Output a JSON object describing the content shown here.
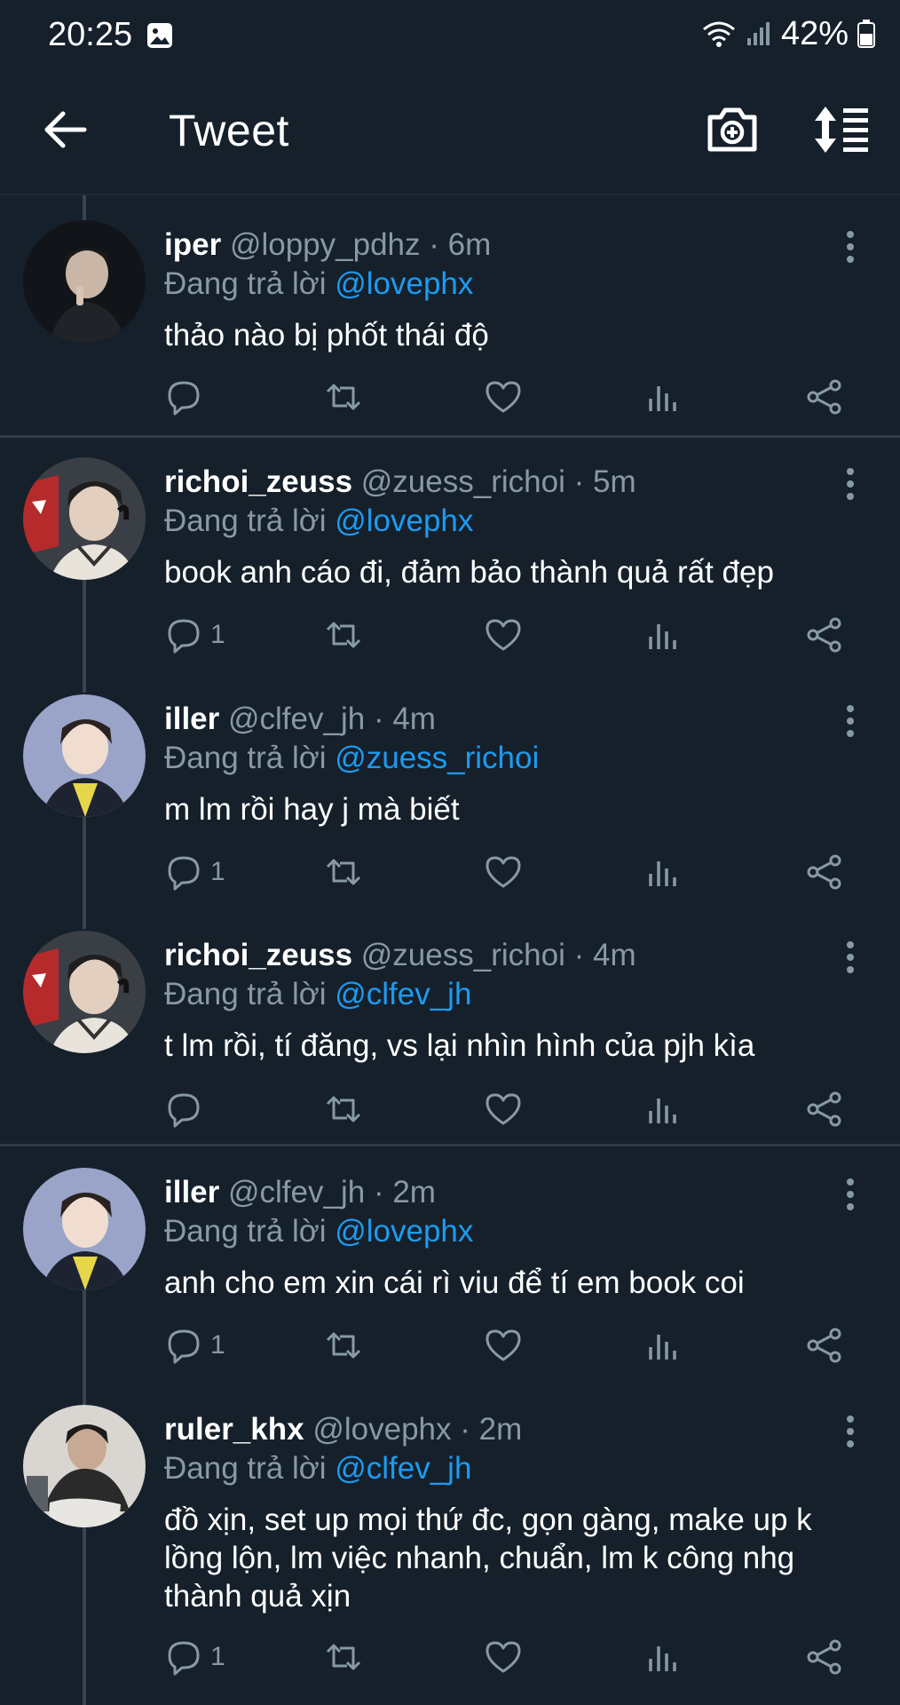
{
  "status": {
    "time": "20:25",
    "battery": "42%"
  },
  "header": {
    "title": "Tweet"
  },
  "tweets": [
    {
      "name": "iper",
      "handle": "@loppy_pdhz",
      "time": "· 6m",
      "reply_prefix": "Đang trả lời",
      "reply_to": "@lovephx",
      "text": "thảo nào bị phốt thái độ",
      "reply_count": ""
    },
    {
      "name": "richoi_zeuss",
      "handle": "@zuess_richoi",
      "time": "· 5m",
      "reply_prefix": "Đang trả lời",
      "reply_to": "@lovephx",
      "text": "book anh cáo đi, đảm bảo thành quả rất đẹp",
      "reply_count": "1"
    },
    {
      "name": "iller",
      "handle": "@clfev_jh",
      "time": "· 4m",
      "reply_prefix": "Đang trả lời",
      "reply_to": "@zuess_richoi",
      "text": "m lm rồi hay j mà biết",
      "reply_count": "1"
    },
    {
      "name": "richoi_zeuss",
      "handle": "@zuess_richoi",
      "time": "· 4m",
      "reply_prefix": "Đang trả lời",
      "reply_to": "@clfev_jh",
      "text": "t lm rồi, tí đăng, vs lại nhìn hình của pjh kìa",
      "reply_count": ""
    },
    {
      "name": "iller",
      "handle": "@clfev_jh",
      "time": "· 2m",
      "reply_prefix": "Đang trả lời",
      "reply_to": "@lovephx",
      "text": "anh cho em xin cái rì viu để tí em book coi",
      "reply_count": "1"
    },
    {
      "name": "ruler_khx",
      "handle": "@lovephx",
      "time": "· 2m",
      "reply_prefix": "Đang trả lời",
      "reply_to": "@clfev_jh",
      "text": "đồ xịn, set up mọi thứ đc, gọn gàng, make up k lồng lộn, lm việc nhanh, chuẩn, lm k công nhg thành quả xịn",
      "reply_count": "1"
    }
  ],
  "colors": {
    "background": "#15202b",
    "accent": "#1d9bf0",
    "muted": "#8899a6"
  }
}
